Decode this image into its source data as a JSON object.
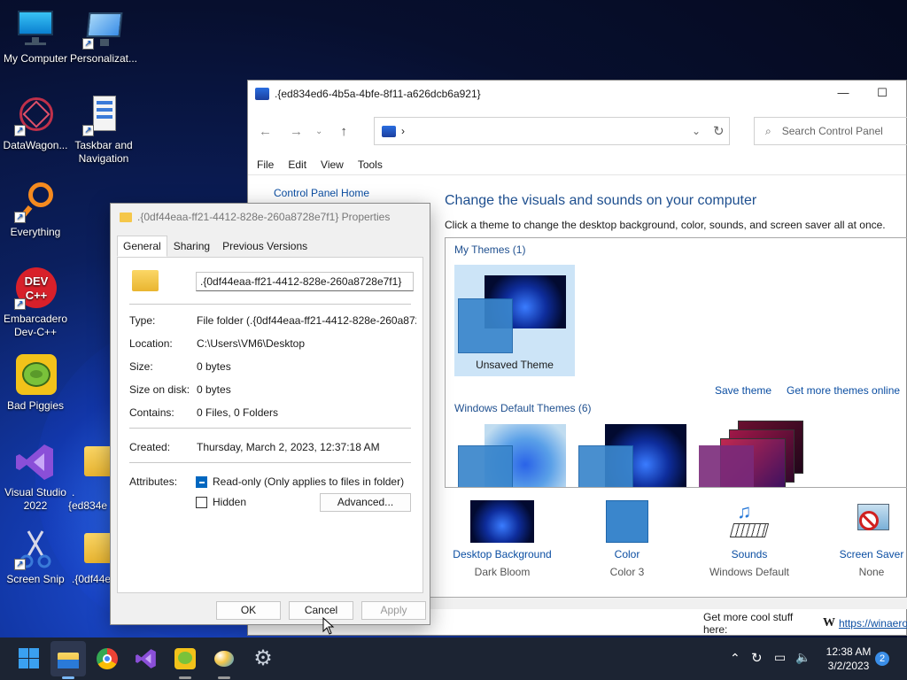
{
  "desktop": {
    "icons": [
      {
        "label": "My Computer"
      },
      {
        "label": "Personalizat..."
      },
      {
        "label": "DataWagon..."
      },
      {
        "label": "Taskbar and Navigation"
      },
      {
        "label": "Everything"
      },
      {
        "label": "Embarcadero Dev-C++"
      },
      {
        "label": "Bad Piggies"
      },
      {
        "label": "Visual Studio 2022"
      },
      {
        "label": ".{ed834e"
      },
      {
        "label": "Screen Snip"
      },
      {
        "label": ".{0df44e"
      }
    ],
    "devcpp_text": "DEV C++"
  },
  "control_panel": {
    "title": ".{ed834ed6-4b5a-4bfe-8f11-a626dcb6a921}",
    "address": "›",
    "search_placeholder": "Search Control Panel",
    "menu": [
      "File",
      "Edit",
      "View",
      "Tools"
    ],
    "home_link": "Control Panel Home",
    "heading": "Change the visuals and sounds on your computer",
    "subtext": "Click a theme to change the desktop background, color, sounds, and screen saver all at once.",
    "my_themes_label": "My Themes (1)",
    "unsaved_theme": "Unsaved Theme",
    "save_theme": "Save theme",
    "get_more": "Get more themes online",
    "default_themes_label": "Windows Default Themes (6)",
    "bottom": [
      {
        "label": "Desktop Background",
        "value": "Dark Bloom"
      },
      {
        "label": "Color",
        "value": "Color 3"
      },
      {
        "label": "Sounds",
        "value": "Windows Default"
      },
      {
        "label": "Screen Saver",
        "value": "None"
      }
    ],
    "status_text": "Get more cool stuff here:",
    "status_w": "W",
    "status_link": "https://winaero"
  },
  "properties": {
    "title": ".{0df44eaa-ff21-4412-828e-260a8728e7f1} Properties",
    "tabs": [
      "General",
      "Sharing",
      "Previous Versions"
    ],
    "name_value": ".{0df44eaa-ff21-4412-828e-260a8728e7f1}",
    "rows": {
      "type": {
        "k": "Type:",
        "v": "File folder (.{0df44eaa-ff21-4412-828e-260a8728e"
      },
      "location": {
        "k": "Location:",
        "v": "C:\\Users\\VM6\\Desktop"
      },
      "size": {
        "k": "Size:",
        "v": "0 bytes"
      },
      "size_on_disk": {
        "k": "Size on disk:",
        "v": "0 bytes"
      },
      "contains": {
        "k": "Contains:",
        "v": "0 Files, 0 Folders"
      },
      "created": {
        "k": "Created:",
        "v": "Thursday, March 2, 2023, 12:37:18 AM"
      }
    },
    "attributes_label": "Attributes:",
    "readonly_label": "Read-only (Only applies to files in folder)",
    "hidden_label": "Hidden",
    "advanced": "Advanced...",
    "ok": "OK",
    "cancel": "Cancel",
    "apply": "Apply"
  },
  "taskbar": {
    "time": "12:38 AM",
    "date": "3/2/2023",
    "notification_count": "2"
  }
}
